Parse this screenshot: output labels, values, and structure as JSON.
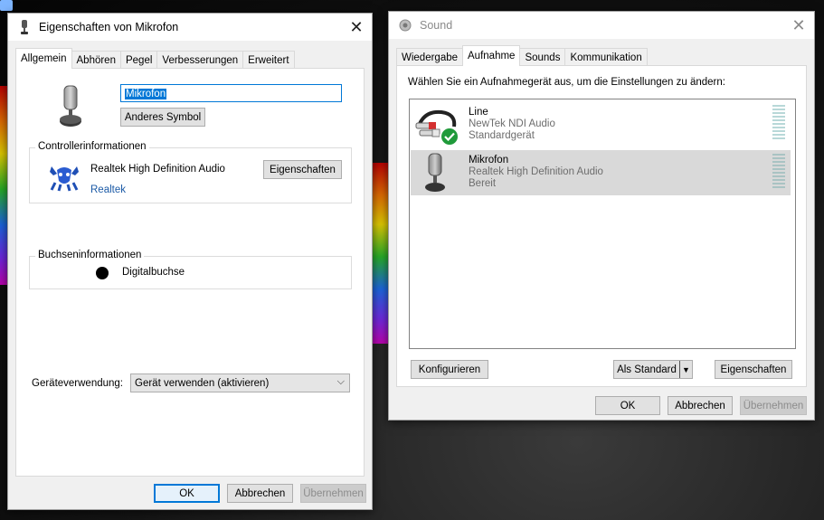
{
  "props_window": {
    "title": "Eigenschaften von Mikrofon",
    "tabs": [
      "Allgemein",
      "Abhören",
      "Pegel",
      "Verbesserungen",
      "Erweitert"
    ],
    "active_tab": 0,
    "name_value": "Mikrofon",
    "change_icon_label": "Anderes Symbol",
    "controller_group": "Controllerinformationen",
    "controller_name": "Realtek High Definition Audio",
    "controller_vendor": "Realtek",
    "properties_label": "Eigenschaften",
    "jack_group": "Buchseninformationen",
    "jack_name": "Digitalbuchse",
    "usage_label": "Geräteverwendung:",
    "usage_value": "Gerät verwenden (aktivieren)",
    "ok_label": "OK",
    "cancel_label": "Abbrechen",
    "apply_label": "Übernehmen"
  },
  "sound_window": {
    "title": "Sound",
    "tabs": [
      "Wiedergabe",
      "Aufnahme",
      "Sounds",
      "Kommunikation"
    ],
    "active_tab": 1,
    "instruction": "Wählen Sie ein Aufnahmegerät aus, um die Einstellungen zu ändern:",
    "devices": [
      {
        "name": "Line",
        "description": "NewTek NDI Audio",
        "status": "Standardgerät",
        "icon": "rca-cable-icon",
        "is_default": true,
        "selected": false
      },
      {
        "name": "Mikrofon",
        "description": "Realtek High Definition Audio",
        "status": "Bereit",
        "icon": "microphone-icon",
        "is_default": false,
        "selected": true
      }
    ],
    "configure_label": "Konfigurieren",
    "set_default_label": "Als Standard",
    "properties_label": "Eigenschaften",
    "ok_label": "OK",
    "cancel_label": "Abbrechen",
    "apply_label": "Übernehmen"
  },
  "colors": {
    "accent": "#0078d7",
    "selection": "#d9d9d9",
    "link": "#1b5aa6",
    "default_check": "#1f9a3a"
  }
}
